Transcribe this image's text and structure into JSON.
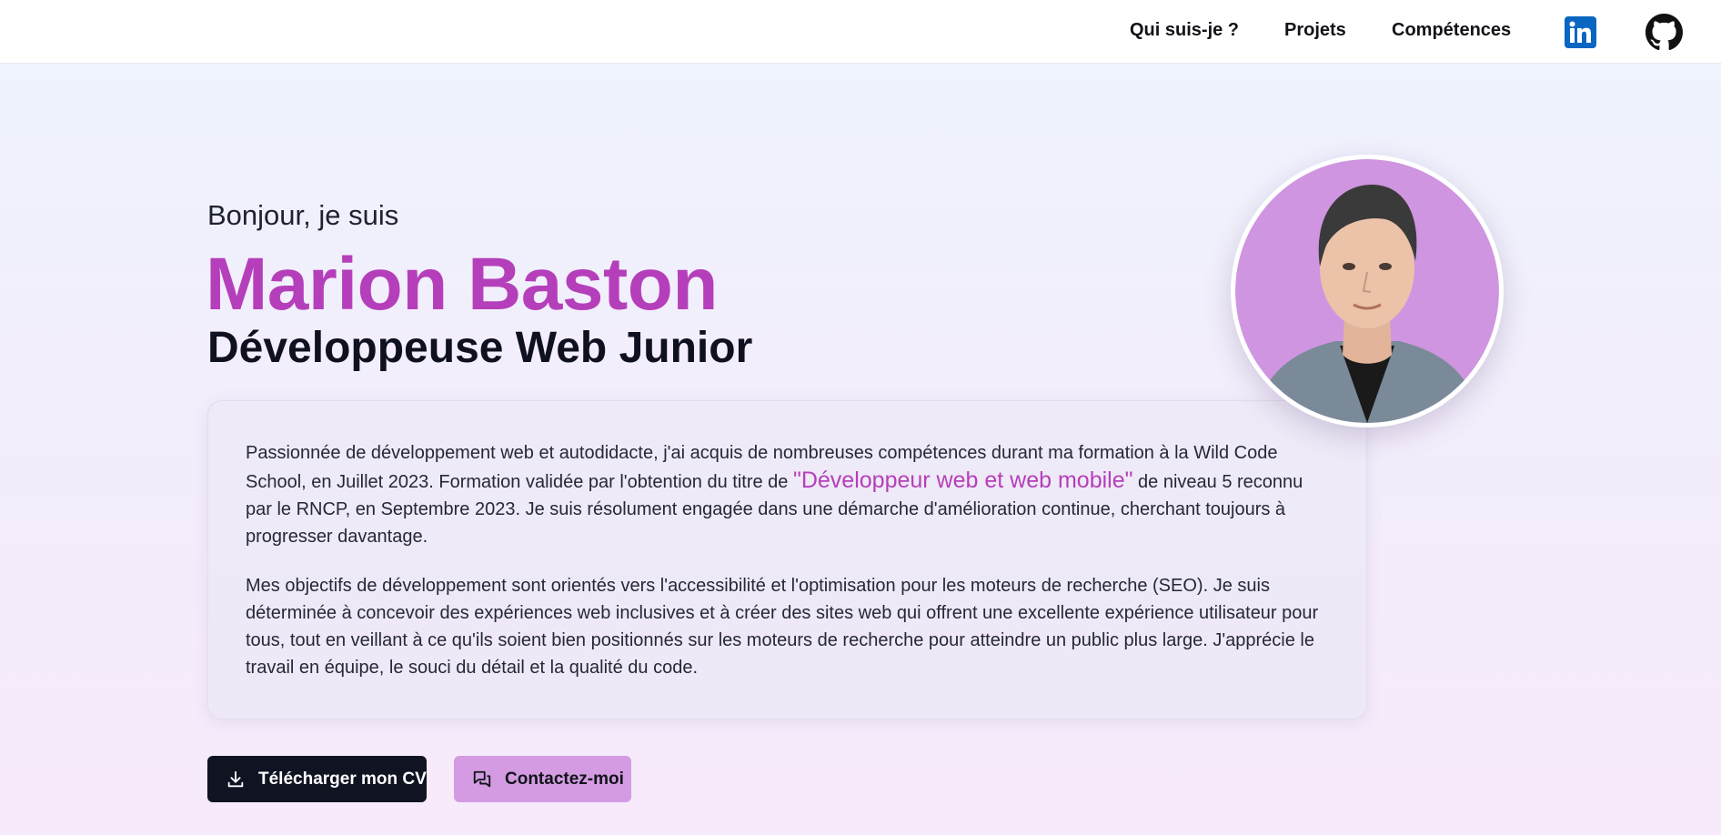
{
  "nav": {
    "about": "Qui suis-je ?",
    "projects": "Projets",
    "skills": "Compétences",
    "linkedin_icon": "linkedin-icon",
    "github_icon": "github-icon"
  },
  "hero": {
    "greeting": "Bonjour, je suis",
    "name": "Marion Baston",
    "role": "Développeuse Web Junior",
    "portrait": "portrait-photo"
  },
  "about": {
    "p1_before": "Passionnée de développement web et autodidacte, j'ai acquis de nombreuses compétences durant ma formation à la Wild Code School, en Juillet 2023. Formation validée par l'obtention du titre de ",
    "p1_highlight": "\"Développeur web et web mobile\"",
    "p1_after": " de niveau 5 reconnu par le RNCP, en Septembre 2023. Je suis résolument engagée dans une démarche d'amélioration continue, cherchant toujours à progresser davantage.",
    "p2": "Mes objectifs de développement sont orientés vers l'accessibilité et l'optimisation pour les moteurs de recherche (SEO). Je suis déterminée à concevoir des expériences web inclusives et à créer des sites web qui offrent une excellente expérience utilisateur pour tous, tout en veillant à ce qu'ils soient bien positionnés sur les moteurs de recherche pour atteindre un public plus large. J'apprécie le travail en équipe, le souci du détail et la qualité du code."
  },
  "actions": {
    "cv_label": "Télécharger mon CV",
    "cv_icon": "download-icon",
    "contact_label": "Contactez-moi",
    "contact_icon": "chat-bubbles-icon"
  },
  "colors": {
    "accent": "#b53fba",
    "dark_button": "#0f1322",
    "contact_button": "#d49be3",
    "portrait_bg": "#cf95e0",
    "linkedin": "#0a66c2"
  }
}
